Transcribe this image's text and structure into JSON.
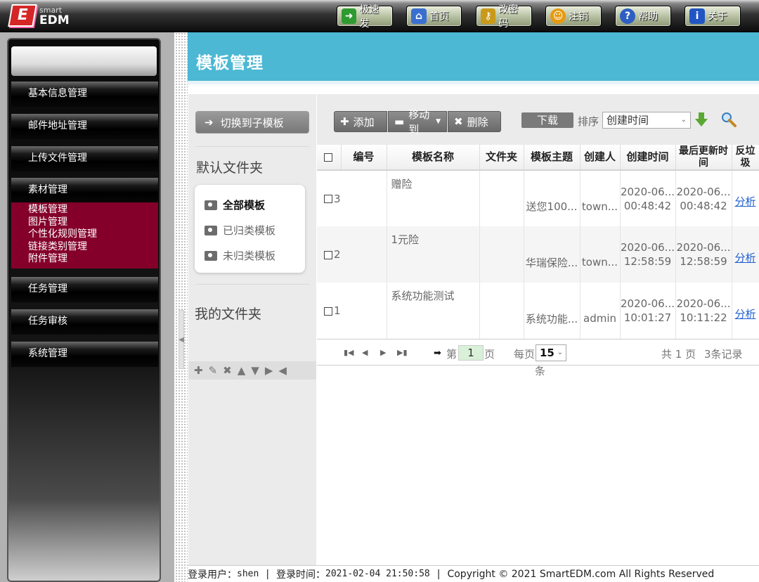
{
  "logo": {
    "small": "smart",
    "big": "EDM"
  },
  "topnav": [
    {
      "label": "极速发",
      "icon": "arrow-icon"
    },
    {
      "label": "首页",
      "icon": "home-icon"
    },
    {
      "label": "改密码",
      "icon": "key-icon"
    },
    {
      "label": "注销",
      "icon": "logout-icon"
    },
    {
      "label": "帮助",
      "icon": "help-icon"
    },
    {
      "label": "关于",
      "icon": "info-icon"
    }
  ],
  "sidebar": {
    "items": [
      "基本信息管理",
      "邮件地址管理",
      "上传文件管理",
      "素材管理",
      "任务管理",
      "任务审核",
      "系统管理"
    ],
    "submenu": [
      "模板管理",
      "图片管理",
      "个性化规则管理",
      "链接类别管理",
      "附件管理"
    ]
  },
  "page": {
    "title": "模板管理"
  },
  "folders": {
    "switch_label": "切换到子模板",
    "default_title": "默认文件夹",
    "items": [
      "全部模板",
      "已归类模板",
      "未归类模板"
    ],
    "my_title": "我的文件夹"
  },
  "toolbar": {
    "add": "添加",
    "move": "移动到",
    "delete": "删除",
    "download": "下载",
    "sort_label": "排序",
    "sort_value": "创建时间"
  },
  "table": {
    "headers": [
      "编号",
      "模板名称",
      "文件夹",
      "模板主题",
      "创建人",
      "创建时间",
      "最后更新时间",
      "反垃圾"
    ],
    "rows": [
      {
        "id": "3",
        "name": "赠险",
        "folder": "",
        "subject": "送您100...",
        "creator": "town...",
        "created_date": "2020-06...",
        "created_time": "00:48:42",
        "updated_date": "2020-06...",
        "updated_time": "00:48:42",
        "action": "分析"
      },
      {
        "id": "2",
        "name": "1元险",
        "folder": "",
        "subject": "华瑞保险...",
        "creator": "town...",
        "created_date": "2020-06...",
        "created_time": "12:58:59",
        "updated_date": "2020-06...",
        "updated_time": "12:58:59",
        "action": "分析"
      },
      {
        "id": "1",
        "name": "系统功能测试",
        "folder": "",
        "subject": "系统功能...",
        "creator": "admin",
        "created_date": "2020-06...",
        "created_time": "10:01:27",
        "updated_date": "2020-06...",
        "updated_time": "10:11:22",
        "action": "分析"
      }
    ]
  },
  "pager": {
    "di": "第",
    "page": "1",
    "ye": "页",
    "per_page_label": "每页",
    "per_page": "15",
    "tiao": "条",
    "total_pages": "共 1 页",
    "total_records": "3条记录"
  },
  "status": {
    "user_label": "登录用户：",
    "user": "shen",
    "time_label": "登录时间：",
    "time": "2021-02-04 21:50:58",
    "copyright": "Copyright © 2021 SmartEDM.com All Rights Reserved"
  },
  "colors": {
    "accent": "#4cb8d4",
    "submenu": "#84002a",
    "link": "#1f5fd0"
  }
}
